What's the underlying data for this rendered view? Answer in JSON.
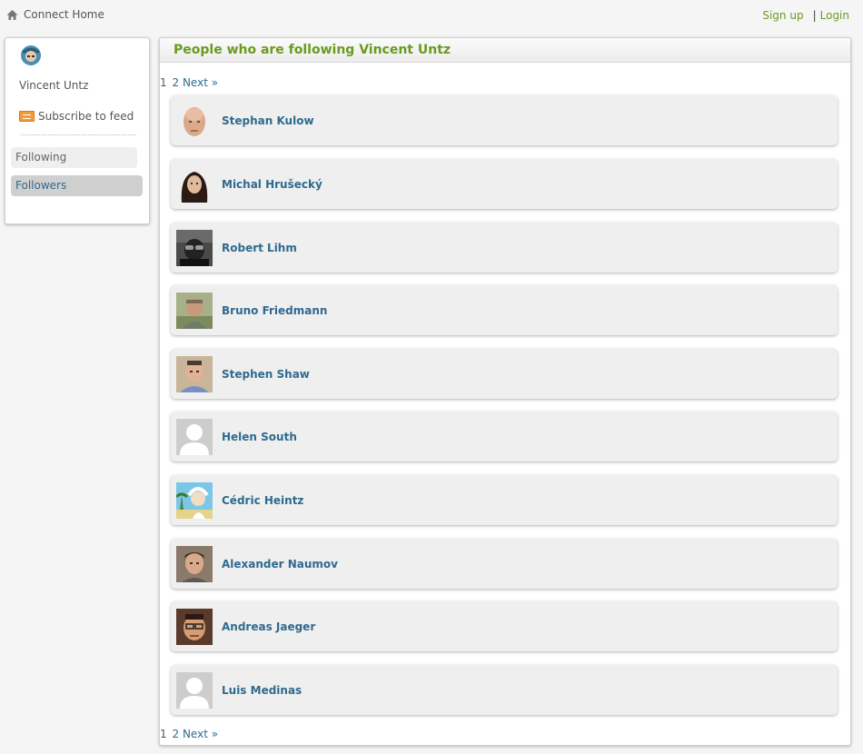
{
  "topbar": {
    "home_label": "Connect Home",
    "signup_label": "Sign up",
    "separator": "|",
    "login_label": "Login"
  },
  "sidebar": {
    "user_name": "Vincent Untz",
    "feed_label": "Subscribe to feed",
    "nav": [
      {
        "label": "Following",
        "active": false
      },
      {
        "label": "Followers",
        "active": true
      }
    ]
  },
  "main": {
    "title": "People who are following Vincent Untz",
    "pager": {
      "current": "1",
      "next_page": "2",
      "next_label": "Next »"
    },
    "people": [
      {
        "name": "Stephan Kulow",
        "avatar": "bald-face"
      },
      {
        "name": "Michal Hrušecký",
        "avatar": "long-dark-hair"
      },
      {
        "name": "Robert Lihm",
        "avatar": "dark-photo"
      },
      {
        "name": "Bruno Friedmann",
        "avatar": "outdoor-photo"
      },
      {
        "name": "Stephen Shaw",
        "avatar": "man-indoor"
      },
      {
        "name": "Helen South",
        "avatar": "default-silhouette"
      },
      {
        "name": "Cédric Heintz",
        "avatar": "cartoon-scientist"
      },
      {
        "name": "Alexander Naumov",
        "avatar": "young-man"
      },
      {
        "name": "Andreas Jaeger",
        "avatar": "man-glasses"
      },
      {
        "name": "Luis Medinas",
        "avatar": "default-silhouette"
      }
    ]
  },
  "colors": {
    "accent_green": "#6a9a1f",
    "link_blue": "#2f6a8f",
    "card_bg": "#efefef"
  }
}
